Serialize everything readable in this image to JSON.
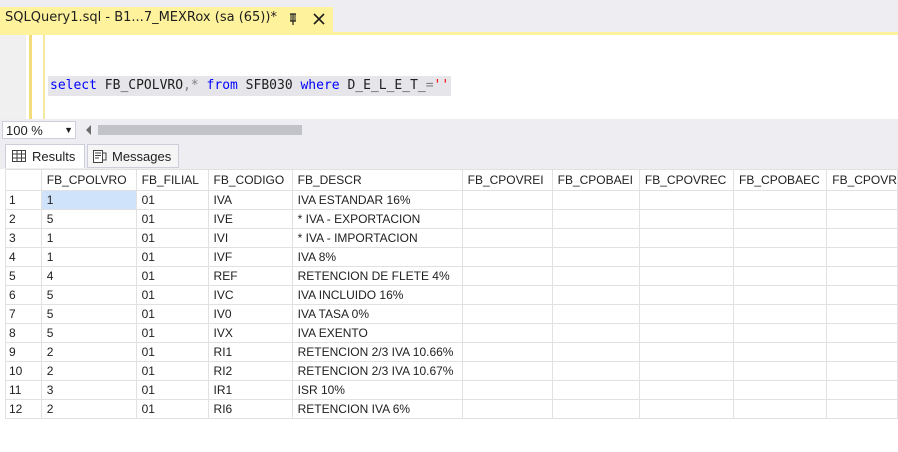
{
  "document_tab": {
    "title": "SQLQuery1.sql - B1...7_MEXRox (sa (65))*"
  },
  "editor": {
    "tokens": {
      "kw_select": "select",
      "col": " FB_CPOLVRO",
      "comma_star": ",*",
      "kw_from": " from",
      "table": " SFB030",
      "kw_where": " where",
      "field": " D_E_L_E_T_",
      "eq": "=",
      "str": "''"
    }
  },
  "zoom": {
    "value": "100 %"
  },
  "results_tabs": {
    "results_label": "Results",
    "messages_label": "Messages"
  },
  "grid": {
    "columns": [
      "FB_CPOLVRO",
      "FB_FILIAL",
      "FB_CODIGO",
      "FB_DESCR",
      "FB_CPOVREI",
      "FB_CPOBAEI",
      "FB_CPOVREC",
      "FB_CPOBAEC",
      "FB_CPOVR"
    ],
    "rows": [
      [
        "1",
        "1",
        "01",
        "IVA",
        "IVA ESTANDAR 16%"
      ],
      [
        "2",
        "5",
        "01",
        "IVE",
        "* IVA - EXPORTACION"
      ],
      [
        "3",
        "1",
        "01",
        "IVI",
        "* IVA - IMPORTACION"
      ],
      [
        "4",
        "1",
        "01",
        "IVF",
        "IVA 8%"
      ],
      [
        "5",
        "4",
        "01",
        "REF",
        "RETENCION DE FLETE 4%"
      ],
      [
        "6",
        "5",
        "01",
        "IVC",
        "IVA INCLUIDO 16%"
      ],
      [
        "7",
        "5",
        "01",
        "IV0",
        "IVA TASA 0%"
      ],
      [
        "8",
        "5",
        "01",
        "IVX",
        "IVA EXENTO"
      ],
      [
        "9",
        "2",
        "01",
        "RI1",
        "RETENCION 2/3 IVA 10.66%"
      ],
      [
        "10",
        "2",
        "01",
        "RI2",
        "RETENCION 2/3 IVA 10.67%"
      ],
      [
        "11",
        "3",
        "01",
        "IR1",
        "ISR 10%"
      ],
      [
        "12",
        "2",
        "01",
        "RI6",
        "RETENCION IVA 6%"
      ]
    ]
  },
  "colors": {
    "tab_active": "#fff29d",
    "keyword": "#0000ff",
    "string": "#ff0000",
    "selection": "#cfe3fa"
  },
  "icons": [
    "pin-icon",
    "close-icon",
    "dropdown-arrow-icon",
    "scroll-left-icon",
    "results-grid-icon",
    "messages-icon"
  ]
}
